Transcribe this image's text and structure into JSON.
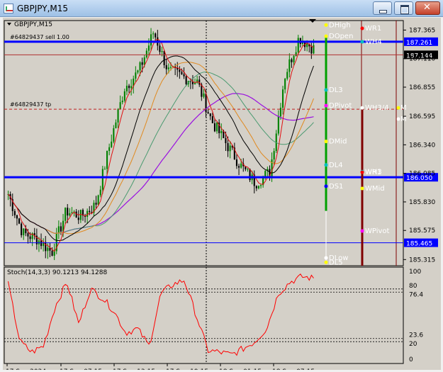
{
  "window": {
    "title": "GBPJPY,M15",
    "symbol_label": "GBPJPY,M15"
  },
  "colors": {
    "background": "#d4d0c8",
    "bull_candle": "#008000",
    "bear_candle": "#000000",
    "ma_red": "#e01010",
    "ma_black": "#000000",
    "ma_orange": "#e08a20",
    "ma_green": "#4a9a70",
    "ma_purple": "#9a10e0",
    "order_line": "#0000ff",
    "stoch": "#ff0000"
  },
  "price_axis": {
    "ticks": [
      "187.365",
      "187.110",
      "186.855",
      "186.595",
      "186.340",
      "186.085",
      "185.830",
      "185.575",
      "185.315"
    ],
    "min": 185.26,
    "max": 187.45
  },
  "time_axis": {
    "ticks": [
      "17 Sep 2024",
      "17 Sep 07:15",
      "17 Sep 13:15",
      "17 Sep 19:15",
      "18 Sep 01:15",
      "18 Sep 07:15"
    ]
  },
  "horizontal_lines": [
    {
      "label": "#64829437 sell 1.00",
      "price": 187.261,
      "price_label": "187.261",
      "style": "thick"
    },
    {
      "label": "",
      "price": 187.144,
      "price_label": "187.144",
      "style": "thin"
    },
    {
      "label": "#64829437 tp",
      "price": 186.658,
      "price_label": "",
      "style": "dash"
    },
    {
      "label": "",
      "price": 186.05,
      "price_label": "186.050",
      "style": "thick"
    },
    {
      "label": "",
      "price": 185.465,
      "price_label": "185.465",
      "style": "thin"
    }
  ],
  "daily_levels": [
    {
      "label": "DHigh",
      "price": 187.41
    },
    {
      "label": "DOpen",
      "price": 187.31
    },
    {
      "label": "DL3",
      "price": 186.83
    },
    {
      "label": "DPivot",
      "price": 186.69
    },
    {
      "label": "DMid",
      "price": 186.37
    },
    {
      "label": "DL4",
      "price": 186.16
    },
    {
      "label": "DS1",
      "price": 185.97
    },
    {
      "label": "DLow",
      "price": 185.33
    },
    {
      "label": "DL5",
      "price": 185.29
    }
  ],
  "weekly_levels": [
    {
      "label": "WR1",
      "price": 187.38
    },
    {
      "label": "WH4",
      "price": 187.26
    },
    {
      "label": "WH3/4",
      "price": 186.67
    },
    {
      "label": "WH3",
      "price": 186.1
    },
    {
      "label": "WR1",
      "price": 186.095
    },
    {
      "label": "WMid",
      "price": 185.95
    },
    {
      "label": "WPivot",
      "price": 185.57
    }
  ],
  "far_labels": [
    {
      "label": "M",
      "price": 186.67
    },
    {
      "label": "M",
      "price": 186.57
    }
  ],
  "stoch": {
    "label": "Stoch(14,3,3) 90.1213 94.1288",
    "levels": [
      "100",
      "80",
      "76.4",
      "23.6",
      "20",
      "0"
    ]
  },
  "chart_data": {
    "type": "line",
    "title": "GBPJPY,M15",
    "xlabel": "",
    "ylabel": "",
    "x": [
      "17 Sep 2024",
      "17 Sep 07:15",
      "17 Sep 13:15",
      "17 Sep 19:15",
      "18 Sep 01:15",
      "18 Sep 07:15"
    ],
    "price_close": [
      185.9,
      185.55,
      185.5,
      185.38,
      185.75,
      185.7,
      185.8,
      186.35,
      186.85,
      187.0,
      187.35,
      187.0,
      186.95,
      186.9,
      186.55,
      186.35,
      186.15,
      186.0,
      186.1,
      186.95,
      187.3,
      187.2
    ],
    "stoch_main": [
      85,
      20,
      8,
      15,
      60,
      88,
      40,
      80,
      70,
      55,
      30,
      35,
      15,
      75,
      85,
      90,
      50,
      10,
      8,
      5,
      12,
      20,
      35,
      75,
      88,
      94,
      92
    ],
    "ylim": [
      185.26,
      187.45
    ],
    "grid": true
  }
}
